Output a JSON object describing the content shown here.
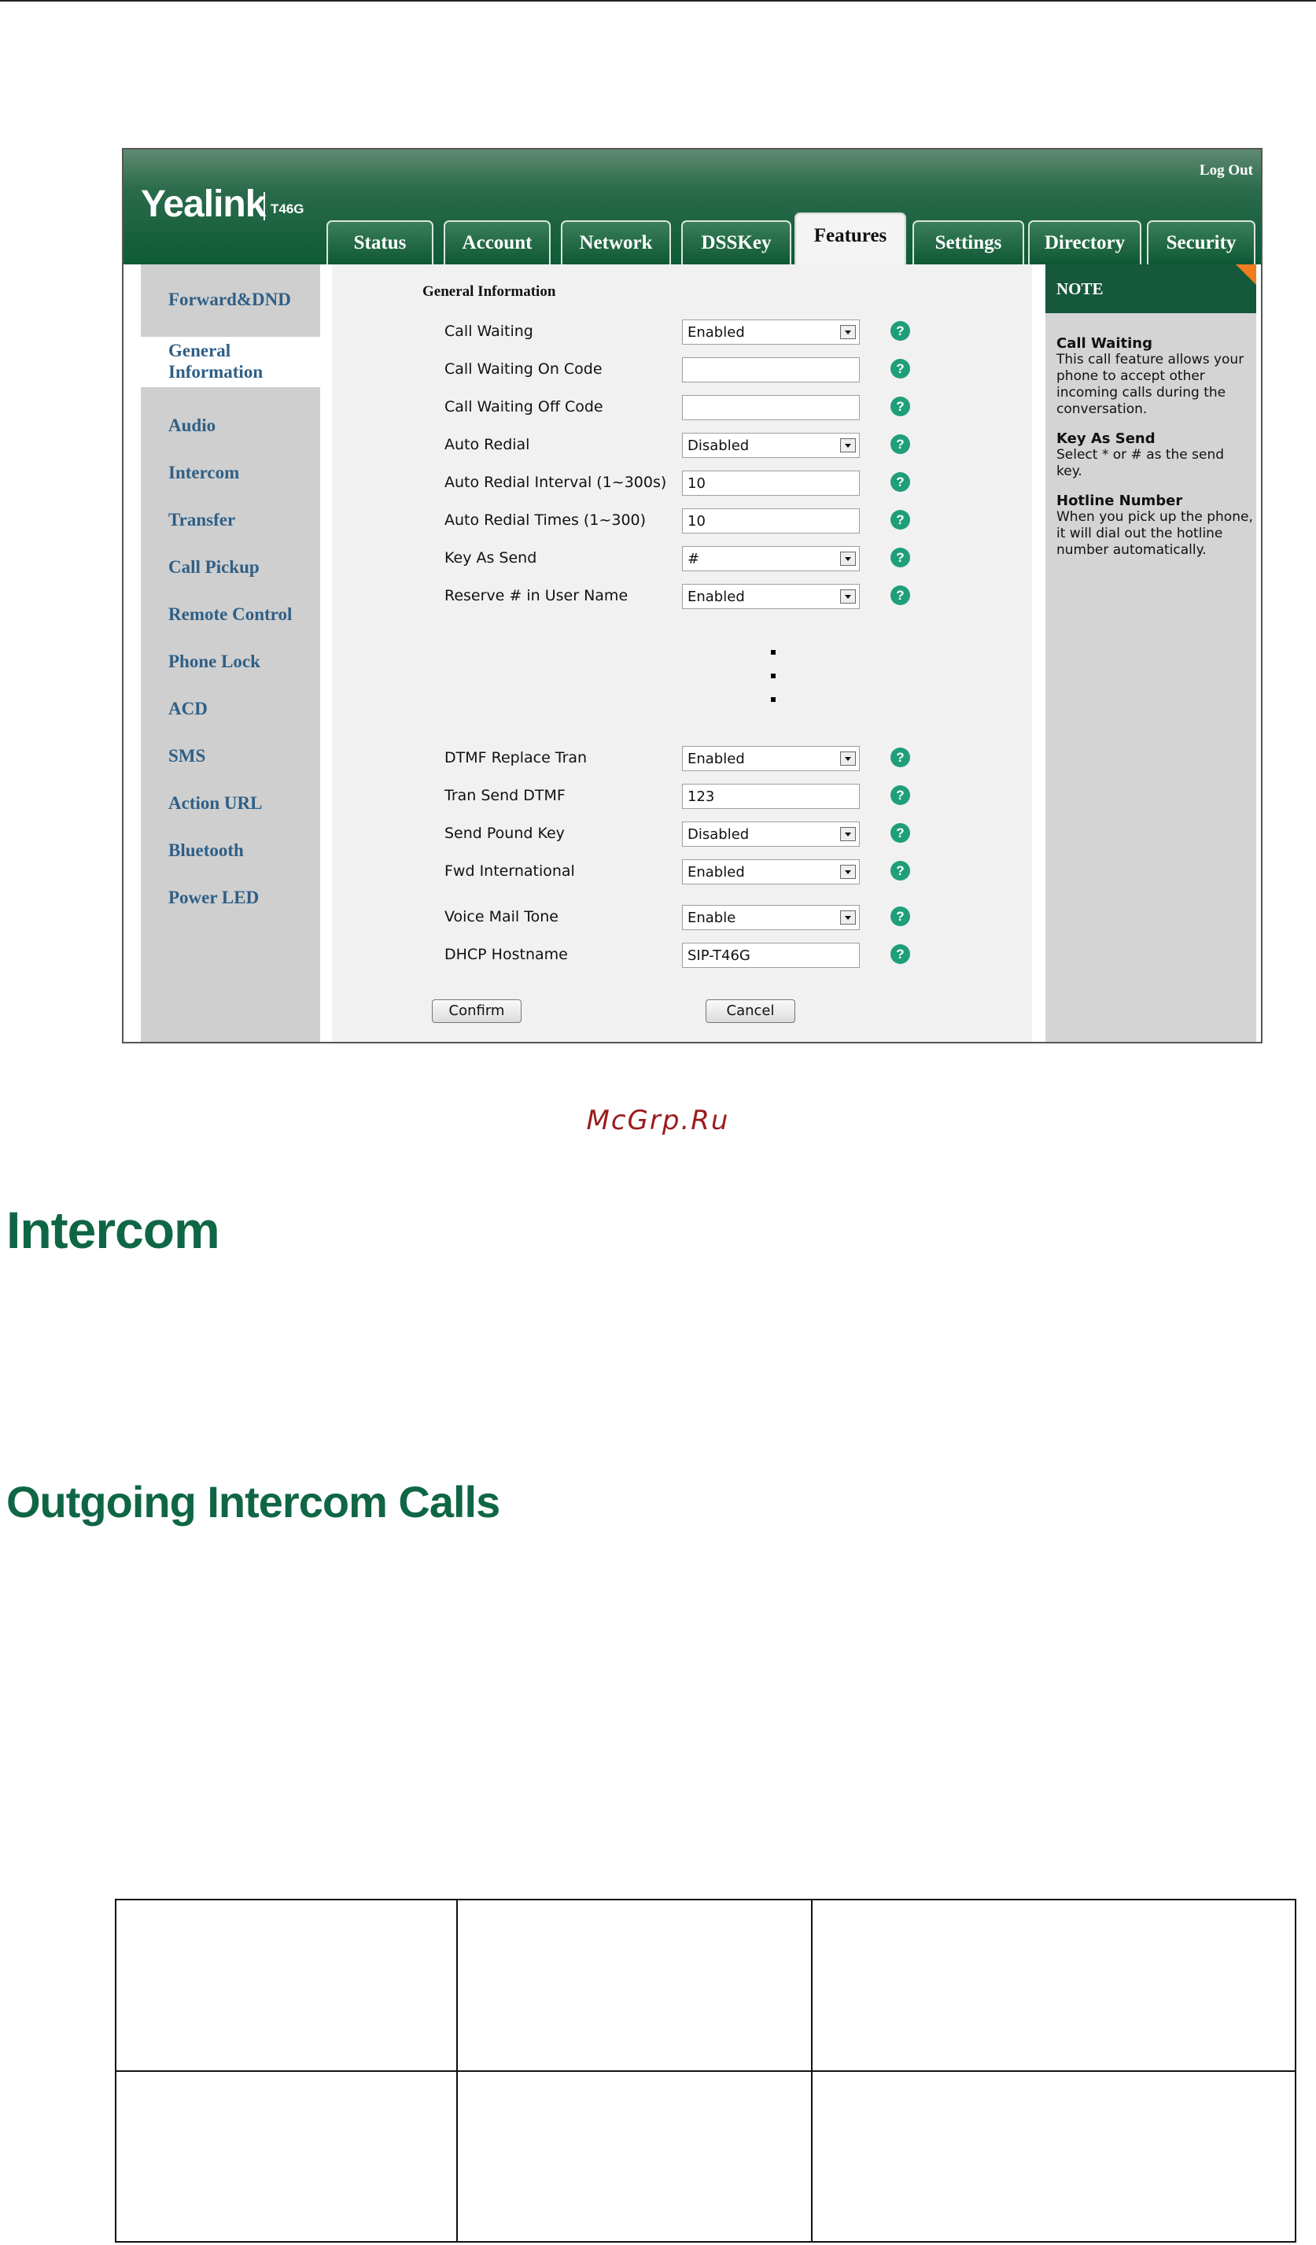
{
  "header": {
    "brand": "Yealink",
    "model": "T46G",
    "logout": "Log Out"
  },
  "tabs": [
    {
      "label": "Status",
      "active": false
    },
    {
      "label": "Account",
      "active": false
    },
    {
      "label": "Network",
      "active": false
    },
    {
      "label": "DSSKey",
      "active": false
    },
    {
      "label": "Features",
      "active": true
    },
    {
      "label": "Settings",
      "active": false
    },
    {
      "label": "Directory",
      "active": false
    },
    {
      "label": "Security",
      "active": false
    }
  ],
  "sidebar": {
    "items": [
      {
        "label": "Forward&DND"
      },
      {
        "label": "General Information",
        "label_line1": "General",
        "label_line2": "Information",
        "active": true
      },
      {
        "label": "Audio"
      },
      {
        "label": "Intercom"
      },
      {
        "label": "Transfer"
      },
      {
        "label": "Call Pickup"
      },
      {
        "label": "Remote Control"
      },
      {
        "label": "Phone Lock"
      },
      {
        "label": "ACD"
      },
      {
        "label": "SMS"
      },
      {
        "label": "Action URL"
      },
      {
        "label": "Bluetooth"
      },
      {
        "label": "Power LED"
      }
    ]
  },
  "form": {
    "section_title": "General Information",
    "rows": [
      {
        "label": "Call Waiting",
        "type": "select",
        "value": "Enabled"
      },
      {
        "label": "Call Waiting On Code",
        "type": "input",
        "value": ""
      },
      {
        "label": "Call Waiting Off Code",
        "type": "input",
        "value": ""
      },
      {
        "label": "Auto Redial",
        "type": "select",
        "value": "Disabled"
      },
      {
        "label": "Auto Redial Interval (1~300s)",
        "type": "input",
        "value": "10"
      },
      {
        "label": "Auto Redial Times (1~300)",
        "type": "input",
        "value": "10"
      },
      {
        "label": "Key As Send",
        "type": "select",
        "value": "#"
      },
      {
        "label": "Reserve # in User Name",
        "type": "select",
        "value": "Enabled"
      },
      {
        "label": "DTMF Replace Tran",
        "type": "select",
        "value": "Enabled"
      },
      {
        "label": "Tran Send DTMF",
        "type": "input",
        "value": "123"
      },
      {
        "label": "Send Pound Key",
        "type": "select",
        "value": "Disabled"
      },
      {
        "label": "Fwd International",
        "type": "select",
        "value": "Enabled"
      },
      {
        "label": "Voice Mail Tone",
        "type": "select",
        "value": "Enable"
      },
      {
        "label": "DHCP Hostname",
        "type": "input",
        "value": "SIP-T46G"
      }
    ],
    "help_glyph": "?",
    "confirm_label": "Confirm",
    "cancel_label": "Cancel"
  },
  "note": {
    "title": "NOTE",
    "entries": [
      {
        "heading": "Call Waiting",
        "text": "This call feature allows your phone to accept other incoming calls during the conversation."
      },
      {
        "heading": "Key As Send",
        "text": "Select * or # as the send key."
      },
      {
        "heading": "Hotline Number",
        "text": "When you pick up the phone, it will dial out the hotline number automatically."
      }
    ]
  },
  "document": {
    "watermark": "McGrp.Ru",
    "heading1": "Intercom",
    "heading2": "Outgoing Intercom Calls",
    "table": {
      "rows": 2,
      "cols": 3
    }
  },
  "colors": {
    "brand_green": "#0e5a37",
    "heading_green": "#0f6645",
    "sidebar_link": "#2f5f86",
    "help_icon": "#1f9e7a",
    "note_corner": "#f07d1e",
    "watermark": "#9b1c1c"
  }
}
